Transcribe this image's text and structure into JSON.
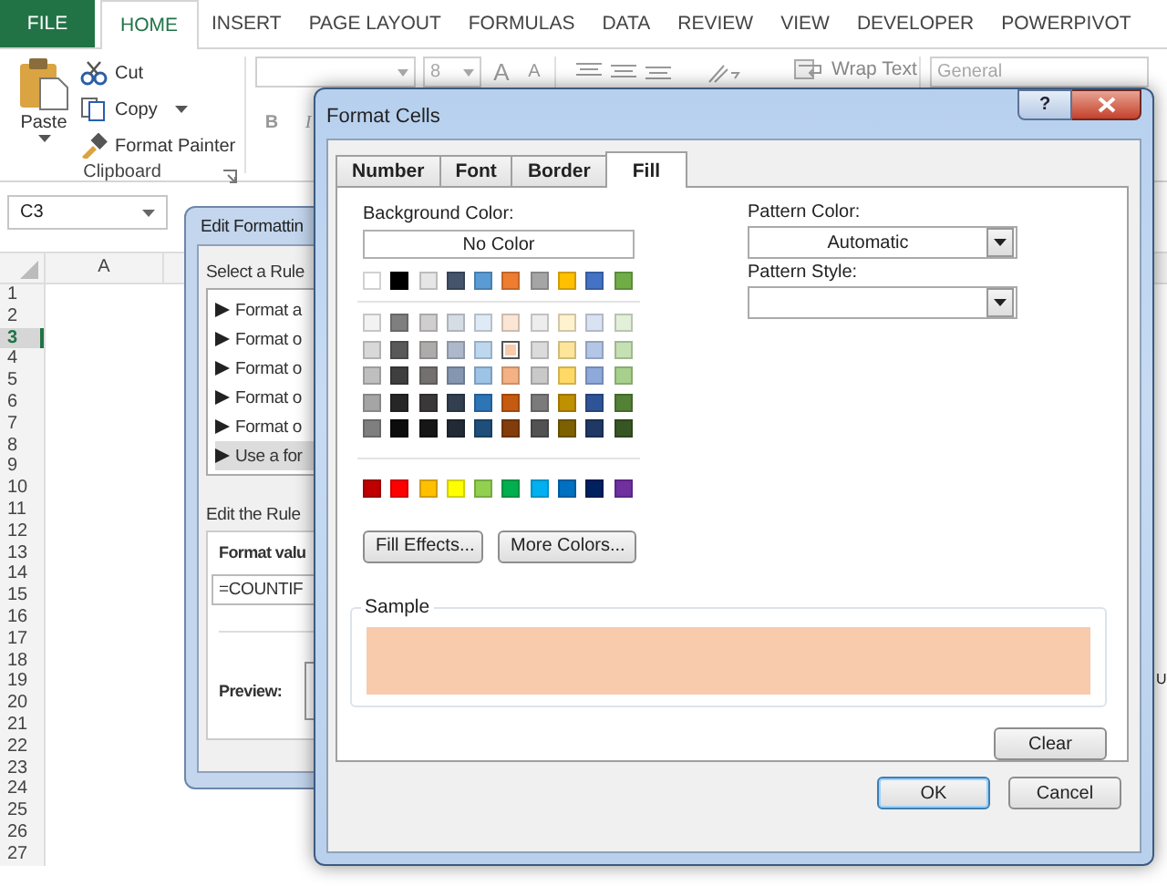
{
  "ribbon_tabs": [
    {
      "label": "FILE",
      "kind": "file",
      "selected": false
    },
    {
      "label": "HOME",
      "kind": "tab",
      "selected": true
    },
    {
      "label": "INSERT",
      "kind": "tab",
      "selected": false
    },
    {
      "label": "PAGE LAYOUT",
      "kind": "tab",
      "selected": false
    },
    {
      "label": "FORMULAS",
      "kind": "tab",
      "selected": false
    },
    {
      "label": "DATA",
      "kind": "tab",
      "selected": false
    },
    {
      "label": "REVIEW",
      "kind": "tab",
      "selected": false
    },
    {
      "label": "VIEW",
      "kind": "tab",
      "selected": false
    },
    {
      "label": "DEVELOPER",
      "kind": "tab",
      "selected": false
    },
    {
      "label": "POWERPIVOT",
      "kind": "tab",
      "selected": false
    }
  ],
  "clipboard": {
    "paste": "Paste",
    "cut": "Cut",
    "copy": "Copy",
    "format_painter": "Format Painter",
    "group_label": "Clipboard"
  },
  "font": {
    "size": "8",
    "grow": "A",
    "shrink": "A",
    "bold": "B",
    "italic": "I"
  },
  "alignment": {
    "wrap_text": "Wrap Text"
  },
  "number": {
    "format": "General"
  },
  "name_box": "C3",
  "column_header": "A",
  "row_headers": [
    {
      "label": "1",
      "selected": false
    },
    {
      "label": "2",
      "selected": false
    },
    {
      "label": "3",
      "selected": true
    },
    {
      "label": "4",
      "selected": false
    },
    {
      "label": "5",
      "selected": false
    },
    {
      "label": "6",
      "selected": false
    },
    {
      "label": "7",
      "selected": false
    },
    {
      "label": "8",
      "selected": false
    },
    {
      "label": "9",
      "selected": false
    },
    {
      "label": "10",
      "selected": false
    },
    {
      "label": "11",
      "selected": false
    },
    {
      "label": "12",
      "selected": false
    },
    {
      "label": "13",
      "selected": false
    },
    {
      "label": "14",
      "selected": false
    },
    {
      "label": "15",
      "selected": false
    },
    {
      "label": "16",
      "selected": false
    },
    {
      "label": "17",
      "selected": false
    },
    {
      "label": "18",
      "selected": false
    },
    {
      "label": "19",
      "selected": false
    },
    {
      "label": "20",
      "selected": false
    },
    {
      "label": "21",
      "selected": false
    },
    {
      "label": "22",
      "selected": false
    },
    {
      "label": "23",
      "selected": false
    },
    {
      "label": "24",
      "selected": false
    },
    {
      "label": "25",
      "selected": false
    },
    {
      "label": "26",
      "selected": false
    },
    {
      "label": "27",
      "selected": false
    }
  ],
  "sheet_fragment": "U",
  "edit_rule_dialog": {
    "title": "Edit Formattin",
    "select_label": "Select a Rule",
    "rules": [
      {
        "label": "Format a",
        "selected": false
      },
      {
        "label": "Format o",
        "selected": false
      },
      {
        "label": "Format o",
        "selected": false
      },
      {
        "label": "Format o",
        "selected": false
      },
      {
        "label": "Format o",
        "selected": false
      },
      {
        "label": "Use a for",
        "selected": true
      }
    ],
    "edit_label": "Edit the Rule",
    "format_label": "Format valu",
    "formula": "=COUNTIF",
    "preview_label": "Preview:"
  },
  "format_cells": {
    "title": "Format Cells",
    "help": "?",
    "tabs": [
      {
        "label": "Number",
        "selected": false
      },
      {
        "label": "Font",
        "selected": false
      },
      {
        "label": "Border",
        "selected": false
      },
      {
        "label": "Fill",
        "selected": true
      }
    ],
    "background_color_label": "Background Color:",
    "no_color": "No Color",
    "swatch_rows": [
      {
        "kind": "theme",
        "swatches": [
          {
            "color": "#ffffff",
            "selected": false
          },
          {
            "color": "#000000",
            "selected": false
          },
          {
            "color": "#e7e6e6",
            "selected": false
          },
          {
            "color": "#44546a",
            "selected": false
          },
          {
            "color": "#5b9bd5",
            "selected": false
          },
          {
            "color": "#ed7d31",
            "selected": false
          },
          {
            "color": "#a5a5a5",
            "selected": false
          },
          {
            "color": "#ffc000",
            "selected": false
          },
          {
            "color": "#4472c4",
            "selected": false
          },
          {
            "color": "#70ad47",
            "selected": false
          }
        ]
      },
      {
        "kind": "shade",
        "swatches": [
          {
            "color": "#f2f2f2",
            "selected": false
          },
          {
            "color": "#7f7f7f",
            "selected": false
          },
          {
            "color": "#d0cece",
            "selected": false
          },
          {
            "color": "#d6dce4",
            "selected": false
          },
          {
            "color": "#deebf6",
            "selected": false
          },
          {
            "color": "#fbe5d5",
            "selected": false
          },
          {
            "color": "#ededed",
            "selected": false
          },
          {
            "color": "#fff2cc",
            "selected": false
          },
          {
            "color": "#d9e2f3",
            "selected": false
          },
          {
            "color": "#e2efd9",
            "selected": false
          }
        ]
      },
      {
        "kind": "shade",
        "swatches": [
          {
            "color": "#d8d8d8",
            "selected": false
          },
          {
            "color": "#595959",
            "selected": false
          },
          {
            "color": "#aeabab",
            "selected": false
          },
          {
            "color": "#adb9ca",
            "selected": false
          },
          {
            "color": "#bdd7ee",
            "selected": false
          },
          {
            "color": "#f7cbac",
            "selected": true
          },
          {
            "color": "#dbdbdb",
            "selected": false
          },
          {
            "color": "#fee599",
            "selected": false
          },
          {
            "color": "#b4c6e7",
            "selected": false
          },
          {
            "color": "#c5e0b3",
            "selected": false
          }
        ]
      },
      {
        "kind": "shade",
        "swatches": [
          {
            "color": "#bfbfbf",
            "selected": false
          },
          {
            "color": "#3f3f3f",
            "selected": false
          },
          {
            "color": "#757070",
            "selected": false
          },
          {
            "color": "#8496b0",
            "selected": false
          },
          {
            "color": "#9dc3e6",
            "selected": false
          },
          {
            "color": "#f4b183",
            "selected": false
          },
          {
            "color": "#c9c9c9",
            "selected": false
          },
          {
            "color": "#ffd965",
            "selected": false
          },
          {
            "color": "#8eaadb",
            "selected": false
          },
          {
            "color": "#a8d08d",
            "selected": false
          }
        ]
      },
      {
        "kind": "shade",
        "swatches": [
          {
            "color": "#a5a5a5",
            "selected": false
          },
          {
            "color": "#262626",
            "selected": false
          },
          {
            "color": "#3a3838",
            "selected": false
          },
          {
            "color": "#323f4f",
            "selected": false
          },
          {
            "color": "#2e75b5",
            "selected": false
          },
          {
            "color": "#c55a11",
            "selected": false
          },
          {
            "color": "#7b7b7b",
            "selected": false
          },
          {
            "color": "#bf9000",
            "selected": false
          },
          {
            "color": "#2f5496",
            "selected": false
          },
          {
            "color": "#538135",
            "selected": false
          }
        ]
      },
      {
        "kind": "shade",
        "swatches": [
          {
            "color": "#7f7f7f",
            "selected": false
          },
          {
            "color": "#0c0c0c",
            "selected": false
          },
          {
            "color": "#171616",
            "selected": false
          },
          {
            "color": "#222a35",
            "selected": false
          },
          {
            "color": "#1e4e79",
            "selected": false
          },
          {
            "color": "#833c0b",
            "selected": false
          },
          {
            "color": "#525252",
            "selected": false
          },
          {
            "color": "#7f6000",
            "selected": false
          },
          {
            "color": "#1f3864",
            "selected": false
          },
          {
            "color": "#375623",
            "selected": false
          }
        ]
      },
      {
        "kind": "standard",
        "swatches": [
          {
            "color": "#c00000",
            "selected": false
          },
          {
            "color": "#ff0000",
            "selected": false
          },
          {
            "color": "#ffc000",
            "selected": false
          },
          {
            "color": "#ffff00",
            "selected": false
          },
          {
            "color": "#92d050",
            "selected": false
          },
          {
            "color": "#00b050",
            "selected": false
          },
          {
            "color": "#00b0f0",
            "selected": false
          },
          {
            "color": "#0070c0",
            "selected": false
          },
          {
            "color": "#002060",
            "selected": false
          },
          {
            "color": "#7030a0",
            "selected": false
          }
        ]
      }
    ],
    "fill_effects": "Fill Effects...",
    "more_colors": "More Colors...",
    "pattern_color_label": "Pattern Color:",
    "pattern_color": "Automatic",
    "pattern_style_label": "Pattern Style:",
    "sample_label": "Sample",
    "clear": "Clear",
    "ok": "OK",
    "cancel": "Cancel"
  }
}
